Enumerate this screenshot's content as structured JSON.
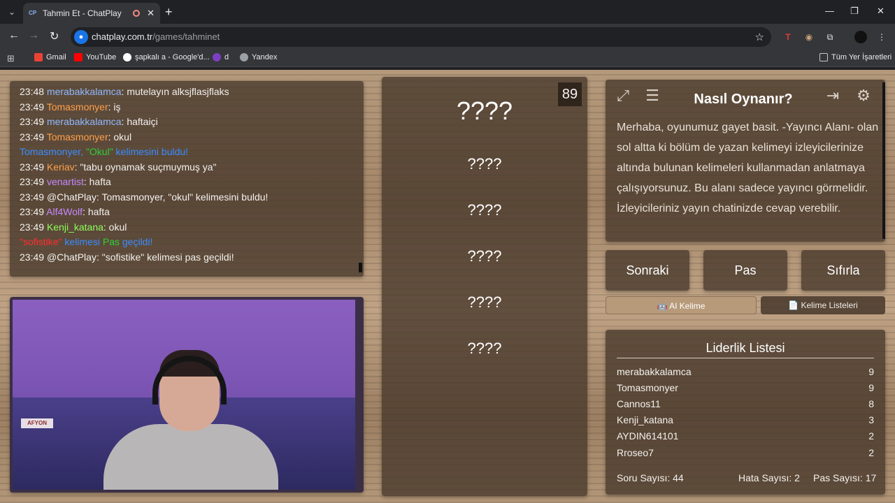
{
  "browser": {
    "tab_favicon": "CP",
    "tab_title": "Tahmin Et - ChatPlay",
    "url_host": "chatplay.com.tr",
    "url_path": "/games/tahminet",
    "bookmarks": [
      "Gmail",
      "YouTube",
      "şapkalı a - Google'd...",
      "d",
      "Yandex"
    ],
    "all_bookmarks": "Tüm Yer İşaretleri"
  },
  "chat": {
    "messages": [
      {
        "time": "23:48",
        "user": "merabakkalamca",
        "user_color": "#8fb8ff",
        "text": ": mutelayın alksjflasjflaks"
      },
      {
        "time": "23:49",
        "user": "Tomasmonyer",
        "user_color": "#ffa04a",
        "text": ": iş"
      },
      {
        "time": "23:49",
        "user": "merabakkalamca",
        "user_color": "#8fb8ff",
        "text": ": haftaiçi"
      },
      {
        "time": "23:49",
        "user": "Tomasmonyer",
        "user_color": "#ffa04a",
        "text": ": okul"
      },
      {
        "time": "23:49",
        "user": "Keriav",
        "user_color": "#ffa04a",
        "text": ": \"tabu oynamak suçmuymuş ya\""
      },
      {
        "time": "23:49",
        "user": "venartist",
        "user_color": "#c58aff",
        "text": ": hafta"
      },
      {
        "time": "23:49",
        "user": "@ChatPlay",
        "user_color": "#f3f1ee",
        "text": ": Tomasmonyer, \"okul\" kelimesini buldu!"
      },
      {
        "time": "23:49",
        "user": "Alf4Wolf",
        "user_color": "#c58aff",
        "text": ": hafta"
      },
      {
        "time": "23:49",
        "user": "Kenji_katana",
        "user_color": "#8cff5a",
        "text": ": okul"
      },
      {
        "time": "23:49",
        "user": "@ChatPlay",
        "user_color": "#f3f1ee",
        "text": ": \"sofistike\" kelimesi pas geçildi!"
      }
    ],
    "event_found": {
      "a": "Tomasmonyer, ",
      "b": "\"Okul\"",
      "c": " kelimesini buldu!"
    },
    "event_pass": {
      "a": "\"sofistike\"",
      "b": " kelimesi ",
      "c": "Pas",
      "d": " geçildi!"
    },
    "colors": {
      "blue": "#3a8cff",
      "green": "#2fcf3a",
      "red": "#ff3030"
    }
  },
  "webcam": {
    "sign_text": "AFYON"
  },
  "words": {
    "counter": "89",
    "main": "????",
    "list": [
      "????",
      "????",
      "????",
      "????",
      "????"
    ]
  },
  "howto": {
    "title": "Nasıl Oynanır?",
    "text": "Merhaba, oyunumuz gayet basit. -Yayıncı Alanı- olan sol altta ki bölüm de yazan kelimeyi izleyicilerinize altında bulunan kelimeleri kullanmadan anlatmaya çalışıyorsunuz. Bu alanı sadece yayıncı görmelidir. İzleyicileriniz yayın chatinizde cevap verebilir.",
    "icons": [
      "expand-icon",
      "list-icon",
      "exit-icon",
      "gear-icon"
    ]
  },
  "actions": {
    "next": "Sonraki",
    "pass": "Pas",
    "reset": "Sıfırla",
    "ai_word": "🤖 AI Kelime",
    "word_lists": "📄 Kelime Listeleri"
  },
  "leaderboard": {
    "title": "Liderlik Listesi",
    "rows": [
      {
        "name": "merabakkalamca",
        "score": "9"
      },
      {
        "name": "Tomasmonyer",
        "score": "9"
      },
      {
        "name": "Cannos11",
        "score": "8"
      },
      {
        "name": "Kenji_katana",
        "score": "3"
      },
      {
        "name": "AYDIN614101",
        "score": "2"
      },
      {
        "name": "Rroseo7",
        "score": "2"
      }
    ],
    "question_count": "Soru Sayısı: 44",
    "error_count": "Hata Sayısı: 2",
    "pass_count": "Pas Sayısı: 17"
  }
}
